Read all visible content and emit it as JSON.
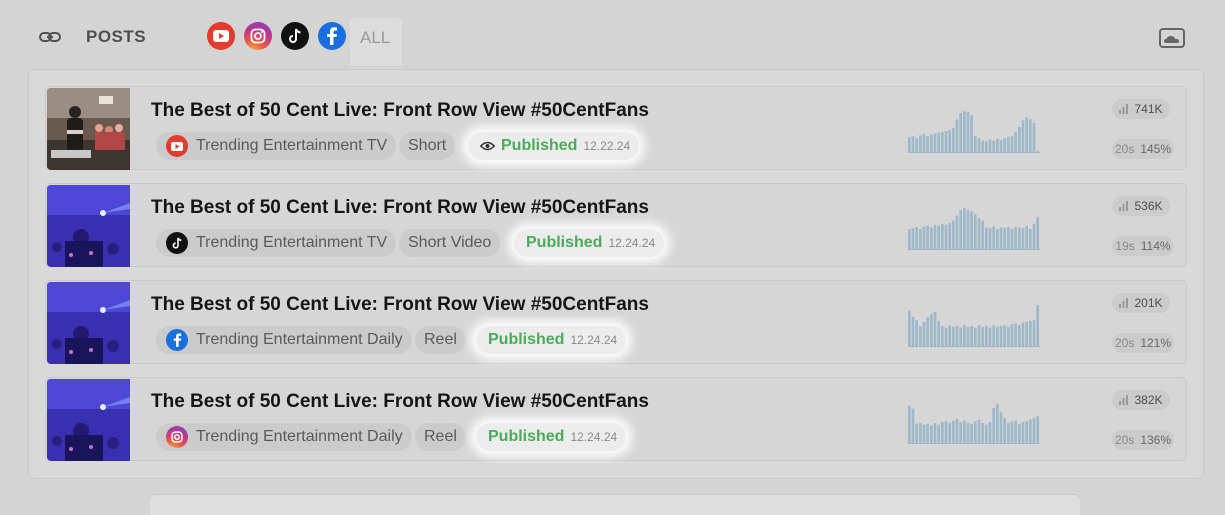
{
  "header": {
    "title": "POSTS",
    "link_icon": "link-icon",
    "filters": [
      {
        "icon": "youtube-icon",
        "color": "#e33b2e"
      },
      {
        "icon": "instagram-icon",
        "color": "#c23391"
      },
      {
        "icon": "tiktok-icon",
        "color": "#111111"
      },
      {
        "icon": "facebook-icon",
        "color": "#1a6fe0"
      }
    ],
    "all_tab": "ALL",
    "cloud_icon": "cloud-screen-icon"
  },
  "colors": {
    "published": "#4caa5c",
    "background": "#d4d4d4",
    "spark": "#9db9c9"
  },
  "posts": [
    {
      "title": "The Best of 50 Cent Live: Front Row View #50CentFans",
      "platform": "youtube",
      "channel": "Trending Entertainment TV",
      "type": "Short",
      "status": "Published",
      "date": "12.22.24",
      "views": "741K",
      "duration": "20s",
      "retention": "145%",
      "spark": [
        0.38,
        0.4,
        0.36,
        0.42,
        0.45,
        0.4,
        0.44,
        0.46,
        0.48,
        0.5,
        0.52,
        0.55,
        0.6,
        0.8,
        0.95,
        1.0,
        0.98,
        0.9,
        0.4,
        0.35,
        0.3,
        0.28,
        0.32,
        0.3,
        0.34,
        0.31,
        0.36,
        0.38,
        0.4,
        0.5,
        0.62,
        0.78,
        0.85,
        0.8,
        0.72,
        0.05
      ]
    },
    {
      "title": "The Best of 50 Cent Live: Front Row View #50CentFans",
      "platform": "tiktok",
      "channel": "Trending Entertainment TV",
      "type": "Short Video",
      "status": "Published",
      "date": "12.24.24",
      "views": "536K",
      "duration": "19s",
      "retention": "114%",
      "spark": [
        0.5,
        0.52,
        0.55,
        0.5,
        0.56,
        0.58,
        0.54,
        0.6,
        0.58,
        0.62,
        0.6,
        0.64,
        0.7,
        0.82,
        0.95,
        1.0,
        0.96,
        0.92,
        0.85,
        0.76,
        0.7,
        0.54,
        0.52,
        0.56,
        0.5,
        0.54,
        0.52,
        0.55,
        0.5,
        0.56,
        0.54,
        0.52,
        0.58,
        0.5,
        0.62,
        0.78
      ]
    },
    {
      "title": "The Best of 50 Cent Live: Front Row View #50CentFans",
      "platform": "facebook",
      "channel": "Trending Entertainment Daily",
      "type": "Reel",
      "status": "Published",
      "date": "12.24.24",
      "views": "201K",
      "duration": "20s",
      "retention": "121%",
      "spark": [
        0.86,
        0.72,
        0.64,
        0.5,
        0.6,
        0.7,
        0.78,
        0.84,
        0.62,
        0.5,
        0.46,
        0.52,
        0.48,
        0.5,
        0.46,
        0.52,
        0.48,
        0.5,
        0.46,
        0.52,
        0.48,
        0.5,
        0.46,
        0.52,
        0.48,
        0.5,
        0.52,
        0.48,
        0.54,
        0.56,
        0.52,
        0.58,
        0.6,
        0.62,
        0.64,
        1.0
      ]
    },
    {
      "title": "The Best of 50 Cent Live: Front Row View #50CentFans",
      "platform": "instagram",
      "channel": "Trending Entertainment Daily",
      "type": "Reel",
      "status": "Published",
      "date": "12.24.24",
      "views": "382K",
      "duration": "20s",
      "retention": "136%",
      "spark": [
        0.92,
        0.84,
        0.48,
        0.5,
        0.46,
        0.48,
        0.44,
        0.5,
        0.46,
        0.52,
        0.54,
        0.5,
        0.56,
        0.6,
        0.52,
        0.56,
        0.5,
        0.48,
        0.54,
        0.58,
        0.5,
        0.46,
        0.52,
        0.86,
        0.96,
        0.76,
        0.62,
        0.5,
        0.54,
        0.56,
        0.48,
        0.52,
        0.54,
        0.58,
        0.62,
        0.66
      ]
    }
  ]
}
